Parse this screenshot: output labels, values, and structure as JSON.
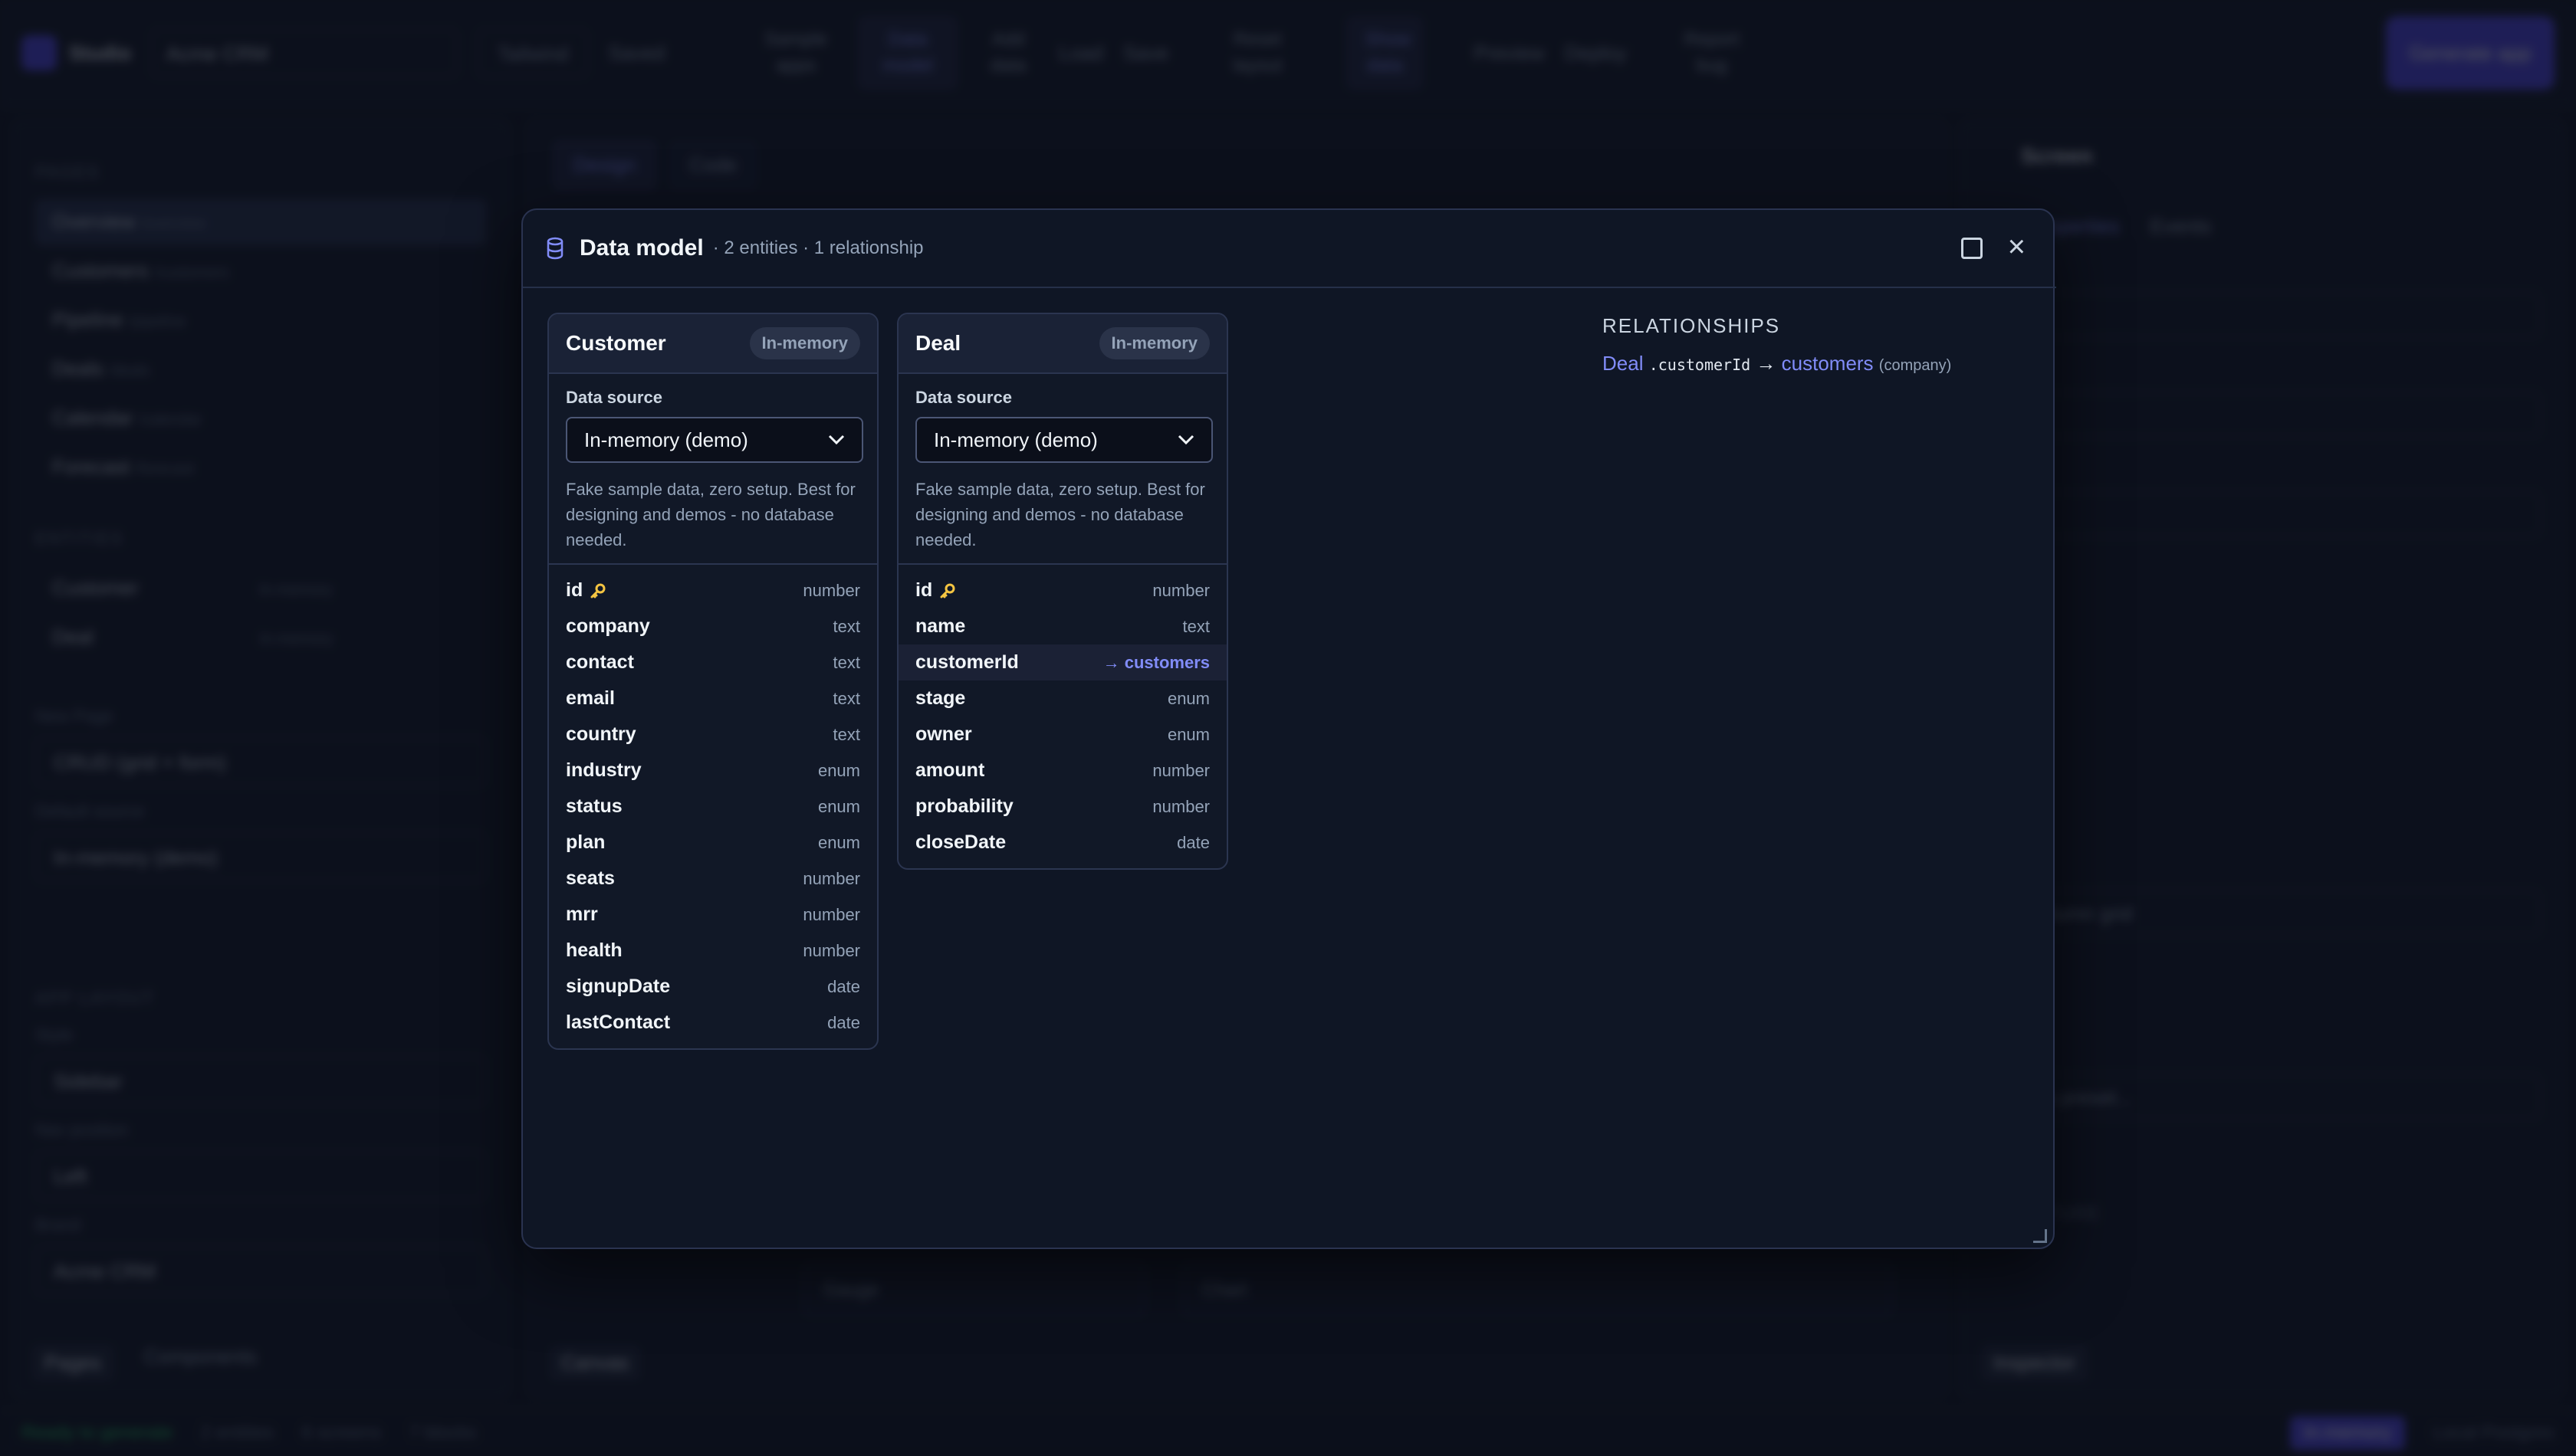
{
  "app": {
    "brand": "Studio",
    "project_name": "Acme CRM",
    "framework": "Tailwind",
    "saved": "Saved",
    "toolbar": {
      "sample_apps": "Sample apps",
      "data_model": "Data model",
      "add_data": "Add data",
      "load": "Load",
      "save": "Save",
      "reset_layout": "Reset layout",
      "show_data": "Show data",
      "preview": "Preview",
      "deploy": "Deploy",
      "report_bug": "Report bug",
      "generate_app": "Generate app"
    }
  },
  "left_panel": {
    "pages_header": "PAGES",
    "pages": [
      {
        "name": "Overview",
        "route": "/overview"
      },
      {
        "name": "Customers",
        "route": "/customers"
      },
      {
        "name": "Pipeline",
        "route": "/pipeline"
      },
      {
        "name": "Deals",
        "route": "/deals"
      },
      {
        "name": "Calendar",
        "route": "/calendar"
      },
      {
        "name": "Forecast",
        "route": "/forecast"
      }
    ],
    "entities_header": "ENTITIES",
    "entities": [
      {
        "name": "Customer",
        "badge": "In-memory"
      },
      {
        "name": "Deal",
        "badge": "In-memory"
      }
    ],
    "new_page_label": "New Page",
    "new_page_value": "CRUD (grid + form)",
    "default_source_label": "Default source",
    "default_source_value": "In-memory (demo)",
    "app_layout_header": "APP LAYOUT",
    "style_label": "Style",
    "style_value": "Sidebar",
    "nav_position_label": "Nav position",
    "nav_position_value": "Left",
    "brand_label": "Brand",
    "brand_value": "Acme CRM",
    "footer_tabs": [
      "Pages",
      "Components"
    ]
  },
  "center_panel": {
    "tabs": [
      "Design",
      "Code"
    ],
    "blocks": [
      "Gauge",
      "Chart"
    ],
    "footer_tab": "Canvas"
  },
  "right_panel": {
    "title": "Screen",
    "tabs": [
      "Properties",
      "Events"
    ],
    "layout_value": "12-column grid",
    "preset_placeholder": "Pick a preset...",
    "structure_header": "STRUCTURE",
    "footer_tab": "Inspector"
  },
  "status_bar": {
    "ready": "Ready to generate",
    "entities": "2 entities",
    "screens": "6 screens",
    "blocks": "7 blocks",
    "chips": [
      "In-memory",
      "Local Postgres"
    ]
  },
  "modal": {
    "title": "Data model",
    "subtitle": "· 2 entities · 1 relationship",
    "icons": {
      "header": "database-icon",
      "maximize": "maximize-icon",
      "close": "close-icon",
      "key": "key-icon"
    },
    "entities": [
      {
        "name": "Customer",
        "badge": "In-memory",
        "source_label": "Data source",
        "source_value": "In-memory (demo)",
        "source_description": "Fake sample data, zero setup. Best for designing and demos - no database needed.",
        "fields": [
          {
            "name": "id",
            "type": "number",
            "primary": true
          },
          {
            "name": "company",
            "type": "text"
          },
          {
            "name": "contact",
            "type": "text"
          },
          {
            "name": "email",
            "type": "text"
          },
          {
            "name": "country",
            "type": "text"
          },
          {
            "name": "industry",
            "type": "enum"
          },
          {
            "name": "status",
            "type": "enum"
          },
          {
            "name": "plan",
            "type": "enum"
          },
          {
            "name": "seats",
            "type": "number"
          },
          {
            "name": "mrr",
            "type": "number"
          },
          {
            "name": "health",
            "type": "number"
          },
          {
            "name": "signupDate",
            "type": "date"
          },
          {
            "name": "lastContact",
            "type": "date"
          }
        ]
      },
      {
        "name": "Deal",
        "badge": "In-memory",
        "source_label": "Data source",
        "source_value": "In-memory (demo)",
        "source_description": "Fake sample data, zero setup. Best for designing and demos - no database needed.",
        "fields": [
          {
            "name": "id",
            "type": "number",
            "primary": true
          },
          {
            "name": "name",
            "type": "text"
          },
          {
            "name": "customerId",
            "type": "→ customers",
            "reference": true,
            "highlighted": true
          },
          {
            "name": "stage",
            "type": "enum"
          },
          {
            "name": "owner",
            "type": "enum"
          },
          {
            "name": "amount",
            "type": "number"
          },
          {
            "name": "probability",
            "type": "number"
          },
          {
            "name": "closeDate",
            "type": "date"
          }
        ]
      }
    ],
    "relationships_header": "RELATIONSHIPS",
    "relationships": [
      {
        "from": "Deal",
        "field": ".customerId",
        "arrow": "→",
        "to": "customers",
        "via": "(company)"
      }
    ],
    "colors": {
      "accent": "#818cf8",
      "key": "#f5c542",
      "background": "#0f1625"
    }
  }
}
